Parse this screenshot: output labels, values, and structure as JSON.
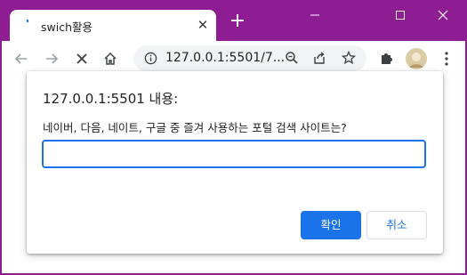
{
  "browser": {
    "tab": {
      "title": "swich활용",
      "close_glyph": "✕"
    },
    "new_tab_glyph": "+",
    "window_controls": {
      "minimize": "—",
      "maximize": "☐",
      "close": "✕"
    },
    "toolbar": {
      "back": "←",
      "forward": "→",
      "stop": "✕",
      "home": "⌂",
      "url": "127.0.0.1:5501/7...",
      "zoom": "⊖",
      "share": "⇗",
      "bookmark": "☆",
      "extensions": "✚",
      "menu": "⋮"
    }
  },
  "dialog": {
    "title": "127.0.0.1:5501 내용:",
    "message": "네이버, 다음, 네이트, 구글 중 즐겨 사용하는 포털 검색 사이트는?",
    "input_value": "",
    "ok_label": "확인",
    "cancel_label": "취소"
  },
  "colors": {
    "frame": "#8e1c92",
    "accent": "#1a73e8"
  }
}
